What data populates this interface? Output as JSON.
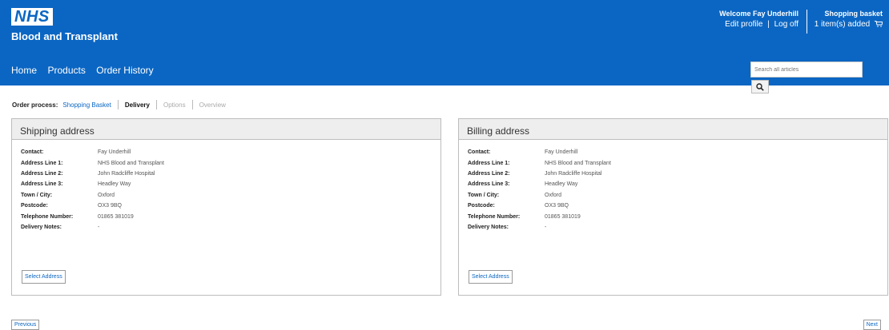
{
  "brand": {
    "logo_text": "NHS",
    "org_name": "Blood and Transplant"
  },
  "user": {
    "welcome": "Welcome Fay Underhill",
    "edit_profile": "Edit profile",
    "separator": "|",
    "log_off": "Log off"
  },
  "basket": {
    "title": "Shopping basket",
    "count_text": "1 item(s) added"
  },
  "nav": {
    "home": "Home",
    "products": "Products",
    "order_history": "Order History"
  },
  "search": {
    "placeholder": "Search all articles"
  },
  "process": {
    "label": "Order process:",
    "steps": [
      "Shopping Basket",
      "Delivery",
      "Options",
      "Overview"
    ]
  },
  "shipping": {
    "title": "Shipping address",
    "fields": [
      {
        "label": "Contact:",
        "value": "Fay Underhill"
      },
      {
        "label": "Address Line 1:",
        "value": "NHS Blood and Transplant"
      },
      {
        "label": "Address Line 2:",
        "value": "John Radcliffe Hospital"
      },
      {
        "label": "Address Line 3:",
        "value": "Headley Way"
      },
      {
        "label": "Town / City:",
        "value": "Oxford"
      },
      {
        "label": "Postcode:",
        "value": "OX3 9BQ"
      },
      {
        "label": "Telephone Number:",
        "value": "01865 381019"
      },
      {
        "label": "Delivery Notes:",
        "value": "-"
      }
    ],
    "button": "Select Address"
  },
  "billing": {
    "title": "Billing address",
    "fields": [
      {
        "label": "Contact:",
        "value": "Fay Underhill"
      },
      {
        "label": "Address Line 1:",
        "value": "NHS Blood and Transplant"
      },
      {
        "label": "Address Line 2:",
        "value": "John Radcliffe Hospital"
      },
      {
        "label": "Address Line 3:",
        "value": "Headley Way"
      },
      {
        "label": "Town / City:",
        "value": "Oxford"
      },
      {
        "label": "Postcode:",
        "value": "OX3 9BQ"
      },
      {
        "label": "Telephone Number:",
        "value": "01865 381019"
      },
      {
        "label": "Delivery Notes:",
        "value": "-"
      }
    ],
    "button": "Select Address"
  },
  "footer": {
    "previous": "Previous",
    "next": "Next"
  },
  "colors": {
    "brand_blue": "#0b66c3",
    "panel_header": "#eeeeee"
  },
  "icons": {
    "cart": "shopping-cart-icon",
    "search": "search-icon"
  }
}
